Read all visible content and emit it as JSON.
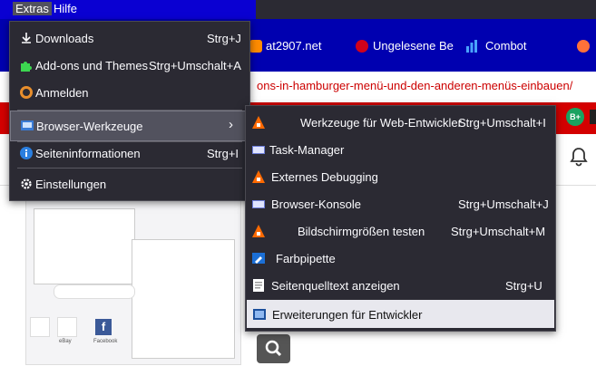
{
  "menubar": {
    "extras": "Extras",
    "hilfe": "Hilfe"
  },
  "bookmarks": [
    {
      "label": "at2907.net"
    },
    {
      "label": "Ungelesene Be"
    },
    {
      "label": "Combot"
    }
  ],
  "url_fragment": "ons-in-hamburger-menü-und-den-anderen-menüs-einbauen/",
  "badge": "B+",
  "extras_menu": {
    "items": [
      {
        "label": "Downloads",
        "shortcut": "Strg+J",
        "icon": "download-icon"
      },
      {
        "label": "Add-ons und Themes",
        "shortcut": "Strg+Umschalt+A",
        "icon": "puzzle-icon"
      },
      {
        "label": "Anmelden",
        "shortcut": "",
        "icon": "account-icon"
      },
      {
        "label": "Browser-Werkzeuge",
        "shortcut": "",
        "icon": "tools-icon"
      },
      {
        "label": "Seiteninformationen",
        "shortcut": "Strg+I",
        "icon": "info-icon"
      },
      {
        "label": "Einstellungen",
        "shortcut": "",
        "icon": "gear-icon"
      }
    ]
  },
  "tools_menu": {
    "items": [
      {
        "label": "Werkzeuge für Web-Entwickler",
        "shortcut": "Strg+Umschalt+I",
        "icon": "devtools-icon"
      },
      {
        "label": "Task-Manager",
        "shortcut": "",
        "icon": "task-manager-icon"
      },
      {
        "label": "Externes Debugging",
        "shortcut": "",
        "icon": "remote-debugging-icon"
      },
      {
        "label": "Browser-Konsole",
        "shortcut": "Strg+Umschalt+J",
        "icon": "console-icon"
      },
      {
        "label": "Bildschirmgrößen testen",
        "shortcut": "Strg+Umschalt+M",
        "icon": "responsive-icon"
      },
      {
        "label": "Farbpipette",
        "shortcut": "",
        "icon": "eyedropper-icon"
      },
      {
        "label": "Seitenquelltext anzeigen",
        "shortcut": "Strg+U",
        "icon": "source-icon"
      },
      {
        "label": "Erweiterungen für Entwickler",
        "shortcut": "",
        "icon": "extensions-dev-icon"
      }
    ]
  },
  "thumbnail": {
    "tiles": [
      {
        "label": "eBay"
      },
      {
        "label": "Facebook"
      }
    ]
  }
}
